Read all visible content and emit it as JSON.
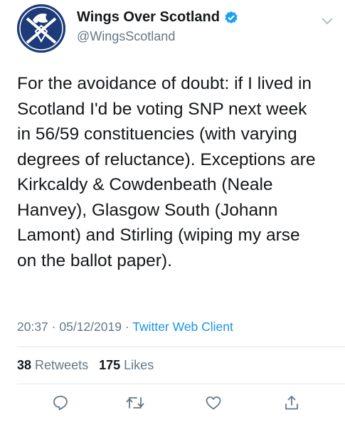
{
  "account": {
    "display_name": "Wings Over Scotland",
    "handle": "@WingsScotland",
    "avatar_icon": "saltire-bird-logo",
    "verified_icon": "verified-badge-icon"
  },
  "tweet": {
    "lines": [
      "For the avoidance of doubt: if I lived in",
      "Scotland I'd be voting SNP next week",
      "in 56/59 constituencies (with varying",
      "degrees of reluctance). Exceptions are",
      "Kirkcaldy & Cowdenbeath (Neale",
      "Hanvey), Glasgow South (Johann",
      "Lamont) and Stirling (wiping my arse",
      "on the ballot paper)."
    ],
    "time": "20:37",
    "date": "05/12/2019",
    "separator": "·",
    "source": "Twitter Web Client"
  },
  "stats": {
    "retweets_count": "38",
    "retweets_label": "Retweets",
    "likes_count": "175",
    "likes_label": "Likes"
  },
  "actions": [
    "reply-icon",
    "retweet-icon",
    "like-icon",
    "share-icon"
  ],
  "colors": {
    "text": "#14171a",
    "secondary": "#657786",
    "link": "#1b95e0",
    "verified": "#1da1f2",
    "avatar_bg": "#1c3b78"
  }
}
